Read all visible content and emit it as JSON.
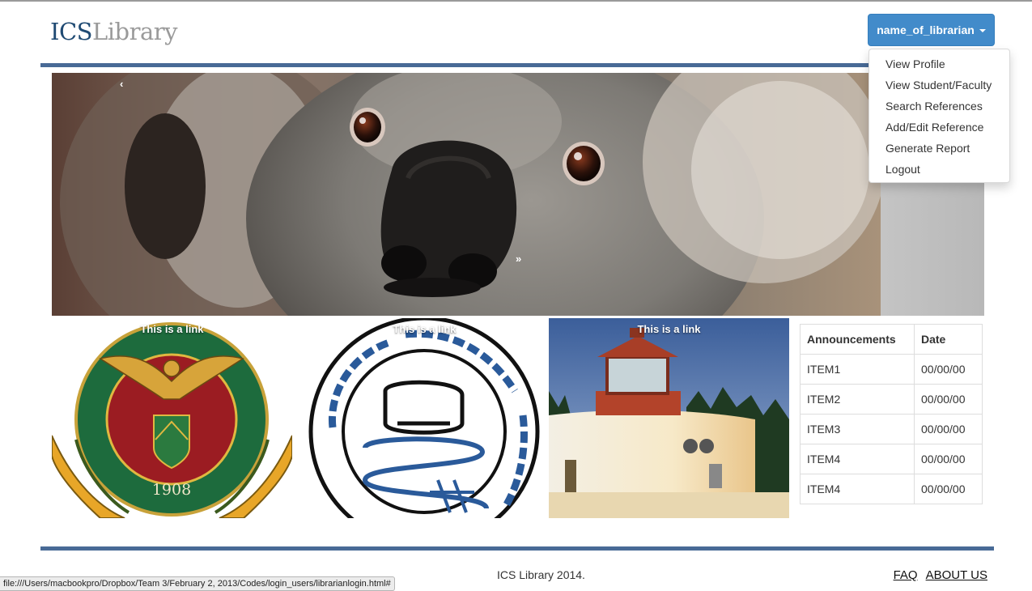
{
  "brand": {
    "part1": "ICS",
    "part2": "Library"
  },
  "user_menu": {
    "label": "name_of_librarian",
    "items": [
      "View Profile",
      "View Student/Faculty",
      "Search References",
      "Add/Edit Reference",
      "Generate Report",
      "Logout"
    ]
  },
  "carousel": {
    "prev": "‹",
    "next": "»"
  },
  "tiles": [
    {
      "link": "This is a link",
      "seal_text": "1908"
    },
    {
      "link": "This is a link"
    },
    {
      "link": "This is a link"
    }
  ],
  "announcements": {
    "headers": [
      "Announcements",
      "Date"
    ],
    "rows": [
      [
        "ITEM1",
        "00/00/00"
      ],
      [
        "ITEM2",
        "00/00/00"
      ],
      [
        "ITEM3",
        "00/00/00"
      ],
      [
        "ITEM4",
        "00/00/00"
      ],
      [
        "ITEM4",
        "00/00/00"
      ]
    ]
  },
  "footer": {
    "copyright": "ICS Library 2014.",
    "links": [
      "FAQ",
      "ABOUT US"
    ]
  },
  "status_url": "file:///Users/macbookpro/Dropbox/Team 3/February 2, 2013/Codes/login_users/librarianlogin.html#",
  "colors": {
    "brand_dark": "#1f4a73",
    "brand_light": "#9a9a9a",
    "rule": "#486a96",
    "button": "#428bca"
  }
}
